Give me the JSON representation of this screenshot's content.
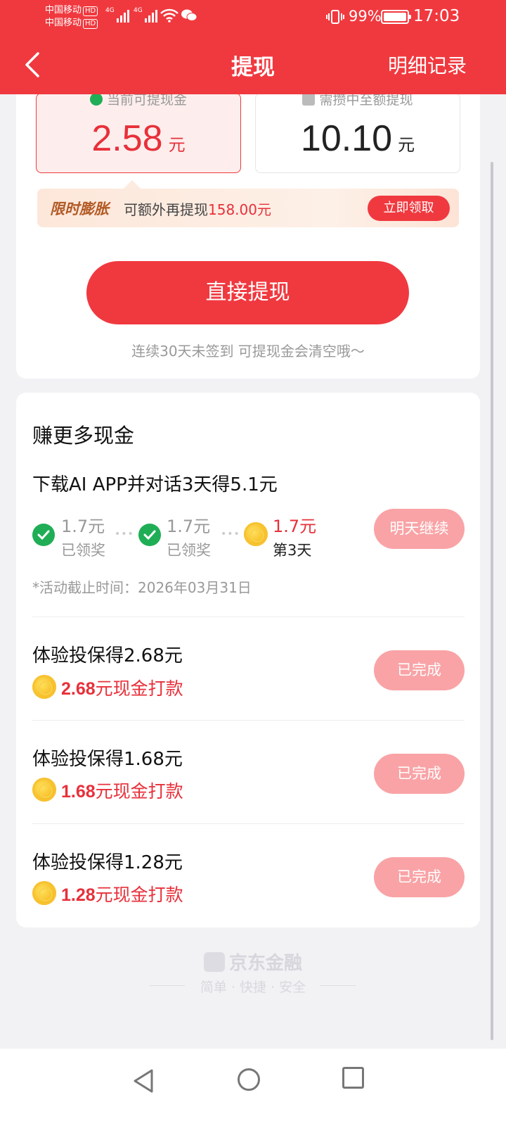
{
  "status_bar": {
    "carrier1": "中国移动",
    "carrier2": "中国移动",
    "hd": "HD",
    "net": "4G",
    "battery": "99%",
    "time": "17:03"
  },
  "header": {
    "title": "提现",
    "right_link": "明细记录"
  },
  "balance": {
    "current_label": "当前可提现金",
    "current_value": "2.58",
    "current_unit": "元",
    "required_label": "需攒中至额提现",
    "required_value": "10.10",
    "required_unit": "元"
  },
  "promo": {
    "tag": "限时膨胀",
    "text": "可额外再提现",
    "amount": "158.00元",
    "button": "立即领取"
  },
  "withdraw": {
    "button": "直接提现",
    "hint": "连续30天未签到 可提现金会清空哦～"
  },
  "earn_more": {
    "title": "赚更多现金",
    "task1": {
      "title": "下载AI APP并对话3天得5.1元",
      "steps": [
        {
          "amount": "1.7元",
          "status": "已领奖"
        },
        {
          "amount": "1.7元",
          "status": "已领奖"
        },
        {
          "amount": "1.7元",
          "status": "第3天"
        }
      ],
      "button": "明天继续",
      "deadline": "*活动截止时间：2026年03月31日"
    },
    "tasks": [
      {
        "title": "体验投保得2.68元",
        "reward_num": "2.68",
        "reward_text": "元现金打款",
        "button": "已完成"
      },
      {
        "title": "体验投保得1.68元",
        "reward_num": "1.68",
        "reward_text": "元现金打款",
        "button": "已完成"
      },
      {
        "title": "体验投保得1.28元",
        "reward_num": "1.28",
        "reward_text": "元现金打款",
        "button": "已完成"
      }
    ]
  },
  "footer": {
    "brand": "京东金融",
    "slogan": "简单 · 快捷 · 安全"
  },
  "colors": {
    "primary": "#f0393f",
    "accent_red": "#e8303a",
    "disabled_button": "#f9a3a6",
    "success_green": "#1fae56"
  }
}
